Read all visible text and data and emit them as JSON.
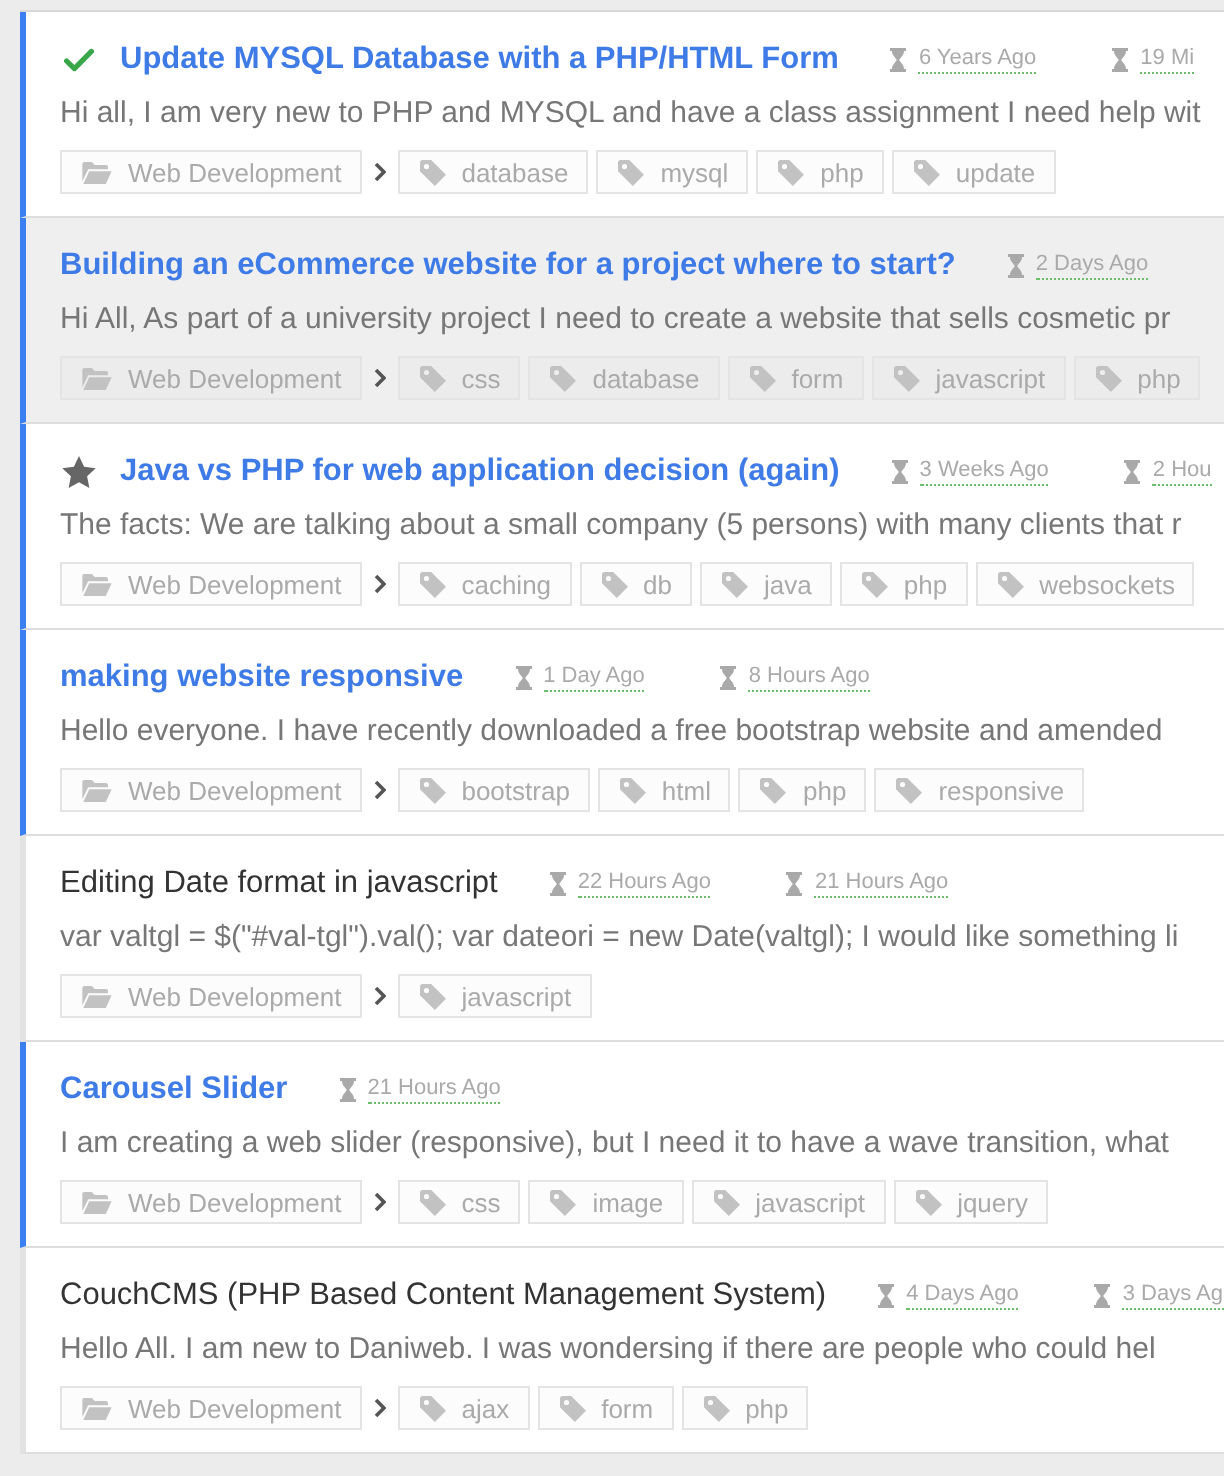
{
  "threads": [
    {
      "title": "Update MYSQL Database with a PHP/HTML Form",
      "unread": true,
      "highlighted": false,
      "solved": true,
      "starred": false,
      "timestamps": [
        "6 Years Ago",
        "19 Mi"
      ],
      "excerpt": "Hi all, I am very new to PHP and MYSQL and have a class assignment I need help wit",
      "category": "Web Development",
      "tags": [
        "database",
        "mysql",
        "php",
        "update"
      ]
    },
    {
      "title": "Building an eCommerce website for a project where to start?",
      "unread": true,
      "highlighted": true,
      "solved": false,
      "starred": false,
      "timestamps": [
        "2 Days Ago"
      ],
      "excerpt": "Hi All, As part of a university project I need to create a website that sells cosmetic pr",
      "category": "Web Development",
      "tags": [
        "css",
        "database",
        "form",
        "javascript",
        "php"
      ]
    },
    {
      "title": "Java vs PHP for web application decision (again)",
      "unread": true,
      "highlighted": false,
      "solved": false,
      "starred": true,
      "timestamps": [
        "3 Weeks Ago",
        "2 Hou"
      ],
      "excerpt": "The facts: We are talking about a small company (5 persons) with many clients that r",
      "category": "Web Development",
      "tags": [
        "caching",
        "db",
        "java",
        "php",
        "websockets"
      ]
    },
    {
      "title": "making website responsive",
      "unread": true,
      "highlighted": false,
      "solved": false,
      "starred": false,
      "timestamps": [
        "1 Day Ago",
        "8 Hours Ago"
      ],
      "excerpt": "Hello everyone. I have recently downloaded a free bootstrap website and amended",
      "category": "Web Development",
      "tags": [
        "bootstrap",
        "html",
        "php",
        "responsive"
      ]
    },
    {
      "title": "Editing Date format in javascript",
      "unread": false,
      "highlighted": false,
      "solved": false,
      "starred": false,
      "timestamps": [
        "22 Hours Ago",
        "21 Hours Ago"
      ],
      "excerpt": "var valtgl = $(\"#val-tgl\").val(); var dateori = new Date(valtgl); I would like something li",
      "category": "Web Development",
      "tags": [
        "javascript"
      ]
    },
    {
      "title": "Carousel Slider",
      "unread": true,
      "highlighted": false,
      "solved": false,
      "starred": false,
      "timestamps": [
        "21 Hours Ago"
      ],
      "excerpt": "I am creating a web slider (responsive), but I need it to have a wave transition, what",
      "category": "Web Development",
      "tags": [
        "css",
        "image",
        "javascript",
        "jquery"
      ]
    },
    {
      "title": "CouchCMS (PHP Based Content Management System)",
      "unread": false,
      "highlighted": false,
      "solved": false,
      "starred": false,
      "timestamps": [
        "4 Days Ago",
        "3 Days Ag"
      ],
      "excerpt": "Hello All. I am new to Daniweb. I was wondersing if there are people who could hel",
      "category": "Web Development",
      "tags": [
        "ajax",
        "form",
        "php"
      ]
    }
  ]
}
